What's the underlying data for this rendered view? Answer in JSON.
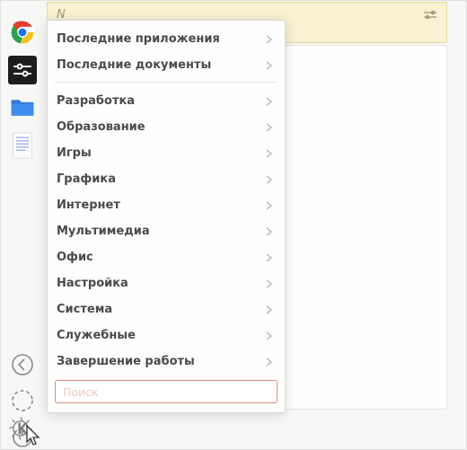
{
  "note_panel": {
    "hint_letter": "N"
  },
  "menu": {
    "recent_apps": "Последние приложения",
    "recent_docs": "Последние документы",
    "categories": [
      {
        "id": "development",
        "label": "Разработка"
      },
      {
        "id": "education",
        "label": "Образование"
      },
      {
        "id": "games",
        "label": "Игры"
      },
      {
        "id": "graphics",
        "label": "Графика"
      },
      {
        "id": "internet",
        "label": "Интернет"
      },
      {
        "id": "multimedia",
        "label": "Мультимедиа"
      },
      {
        "id": "office",
        "label": "Офис"
      },
      {
        "id": "settings",
        "label": "Настройка"
      },
      {
        "id": "system",
        "label": "Система"
      },
      {
        "id": "utilities",
        "label": "Служебные"
      },
      {
        "id": "leave",
        "label": "Завершение работы"
      }
    ],
    "search_placeholder": "Поиск"
  },
  "launcher_items": [
    {
      "id": "chrome",
      "name": "chrome-icon"
    },
    {
      "id": "settings",
      "name": "settings-panel-icon"
    },
    {
      "id": "files",
      "name": "files-icon"
    },
    {
      "id": "document",
      "name": "document-icon"
    }
  ],
  "panel_controls": [
    {
      "id": "back",
      "name": "back-icon"
    },
    {
      "id": "refresh",
      "name": "refresh-icon"
    },
    {
      "id": "power",
      "name": "power-icon"
    }
  ],
  "colors": {
    "accent": "#d88d7f",
    "note_bg": "#f8f1d2",
    "folder_blue": "#2f7bd8"
  }
}
